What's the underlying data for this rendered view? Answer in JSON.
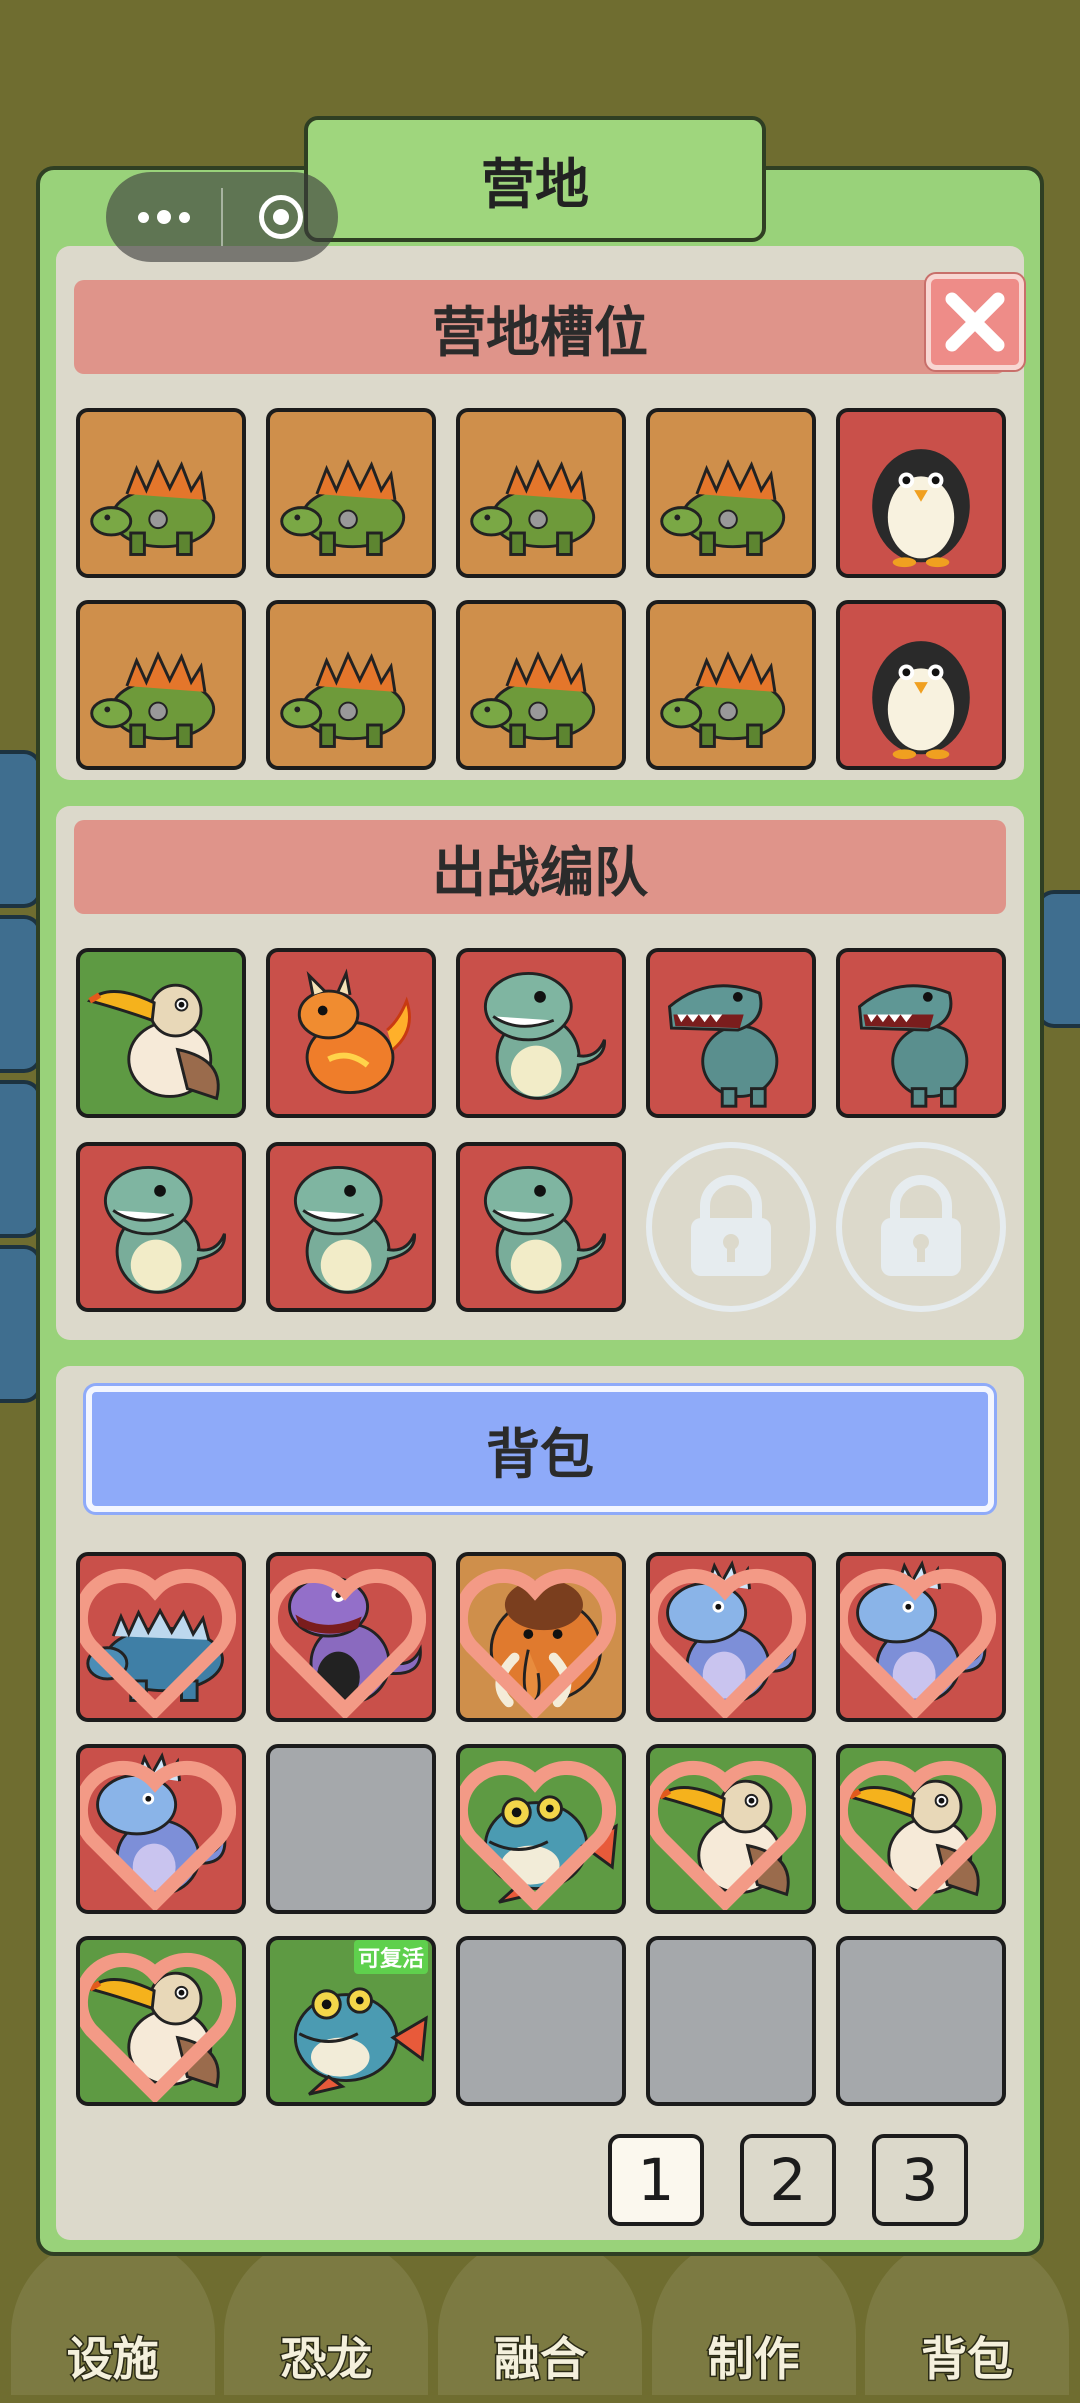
{
  "colors": {
    "panel": "#99d27a",
    "red_header": "#df948a",
    "blue_header": "#8eaaf9",
    "slot_orange": "#cf8f4b",
    "slot_red": "#c9504a",
    "slot_green": "#5e9a43",
    "slot_empty": "#a5a8ab"
  },
  "panel": {
    "title": "营地"
  },
  "capsule": {
    "more_icon": "more-dots-icon",
    "close_icon": "record-circle-icon"
  },
  "camp": {
    "header": "营地槽位",
    "close_icon": "close-x-icon",
    "slots": [
      {
        "creature": "stegosaurus",
        "bg": "orange"
      },
      {
        "creature": "stegosaurus",
        "bg": "orange"
      },
      {
        "creature": "stegosaurus",
        "bg": "orange"
      },
      {
        "creature": "stegosaurus",
        "bg": "orange"
      },
      {
        "creature": "penguin",
        "bg": "red"
      },
      {
        "creature": "stegosaurus",
        "bg": "orange"
      },
      {
        "creature": "stegosaurus",
        "bg": "orange"
      },
      {
        "creature": "stegosaurus",
        "bg": "orange"
      },
      {
        "creature": "stegosaurus",
        "bg": "orange"
      },
      {
        "creature": "penguin",
        "bg": "red"
      }
    ]
  },
  "team": {
    "header": "出战编队",
    "slots": [
      {
        "creature": "toucan",
        "bg": "green"
      },
      {
        "creature": "fire-dragon",
        "bg": "red"
      },
      {
        "creature": "green-dino",
        "bg": "red"
      },
      {
        "creature": "trex",
        "bg": "red"
      },
      {
        "creature": "trex",
        "bg": "red"
      },
      {
        "creature": "green-dino",
        "bg": "red"
      },
      {
        "creature": "green-dino",
        "bg": "red"
      },
      {
        "creature": "green-dino",
        "bg": "red"
      },
      {
        "creature": "locked"
      },
      {
        "creature": "locked"
      }
    ]
  },
  "bag": {
    "header": "背包",
    "revive_label": "可复活",
    "slots": [
      {
        "creature": "ankylosaurus",
        "bg": "red",
        "heart": true
      },
      {
        "creature": "purple-dino",
        "bg": "red",
        "heart": true
      },
      {
        "creature": "mammoth",
        "bg": "orange",
        "heart": true
      },
      {
        "creature": "ice-dino",
        "bg": "red",
        "heart": true
      },
      {
        "creature": "ice-dino",
        "bg": "red",
        "heart": true
      },
      {
        "creature": "ice-dino",
        "bg": "red",
        "heart": true
      },
      {
        "creature": "empty"
      },
      {
        "creature": "fish",
        "bg": "green",
        "heart": true
      },
      {
        "creature": "toucan",
        "bg": "green",
        "heart": true
      },
      {
        "creature": "toucan",
        "bg": "green",
        "heart": true
      },
      {
        "creature": "toucan",
        "bg": "green",
        "heart": true
      },
      {
        "creature": "fish",
        "bg": "green",
        "revive": true
      },
      {
        "creature": "empty"
      },
      {
        "creature": "empty"
      },
      {
        "creature": "empty"
      }
    ],
    "pages": [
      "1",
      "2",
      "3"
    ],
    "current_page": "1"
  },
  "bottom_nav": [
    "设施",
    "恐龙",
    "融合",
    "制作",
    "背包"
  ]
}
